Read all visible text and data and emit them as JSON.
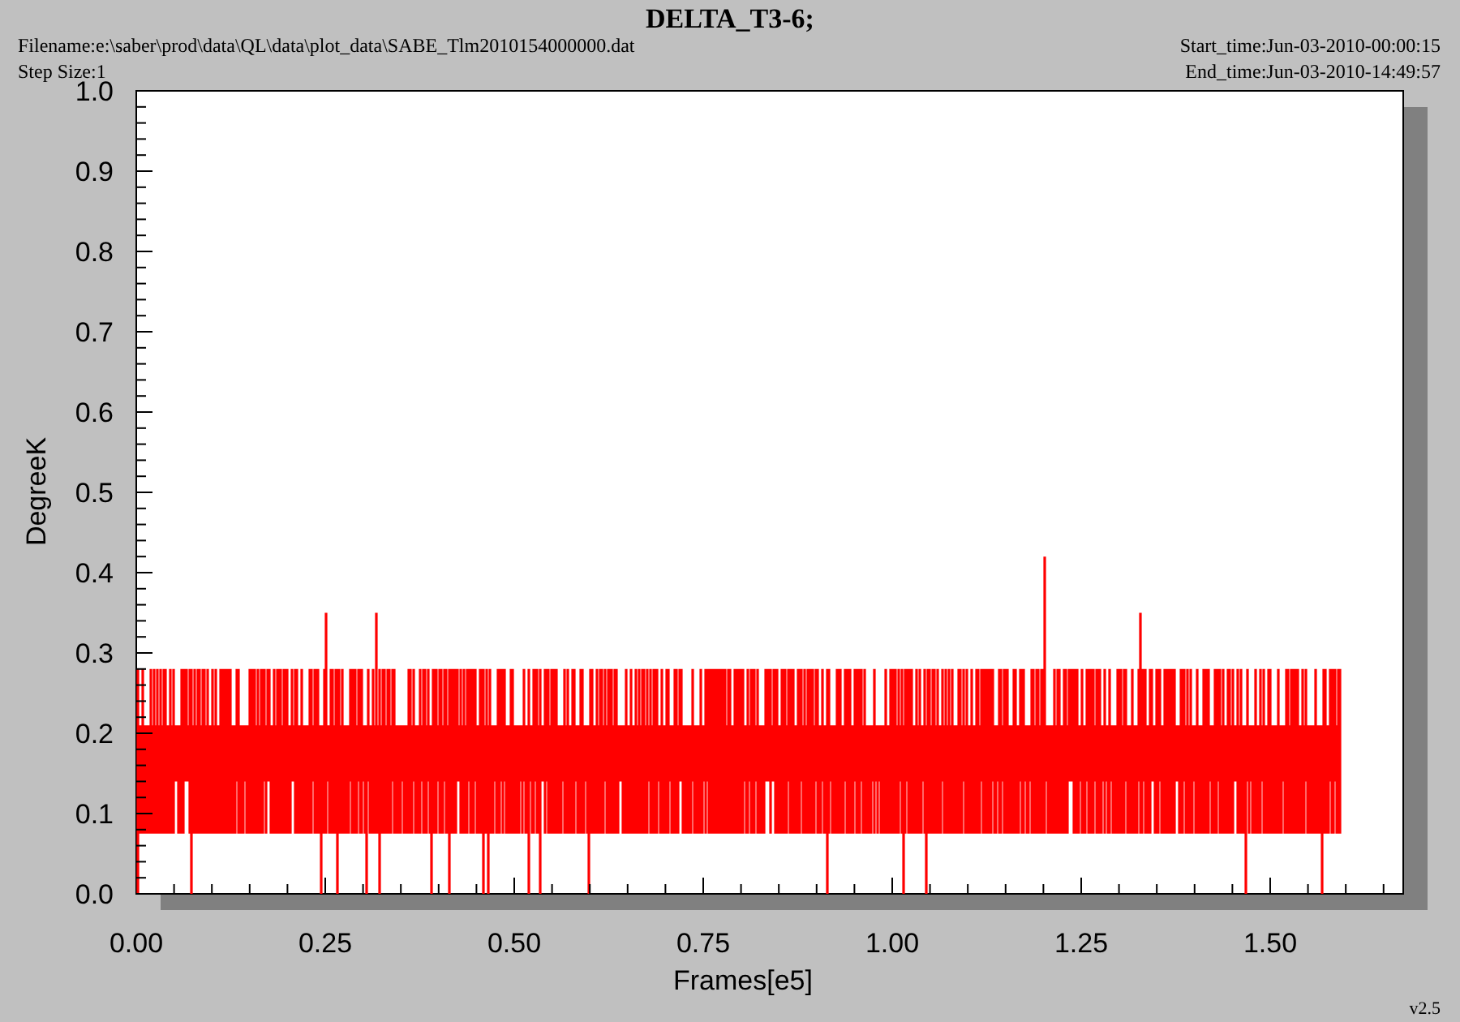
{
  "plot": {
    "title": "DELTA_T3-6;",
    "filename": "Filename:e:\\saber\\prod\\data\\QL\\data\\plot_data\\SABE_Tlm2010154000000.dat",
    "step_size": "Step Size:1",
    "start_time": "Start_time:Jun-03-2010-00:00:15",
    "end_time": "End_time:Jun-03-2010-14:49:57",
    "y_axis": {
      "label": "DegreeK",
      "ticks": [
        "1.0",
        "0.9",
        "0.8",
        "0.7",
        "0.6",
        "0.5",
        "0.4",
        "0.3",
        "0.2",
        "0.1",
        "0.0"
      ]
    },
    "x_axis": {
      "label": "Frames[e5]",
      "ticks": [
        "0.00",
        "0.25",
        "0.50",
        "0.75",
        "1.00",
        "1.25",
        "1.50"
      ]
    },
    "version": "v2.5"
  }
}
